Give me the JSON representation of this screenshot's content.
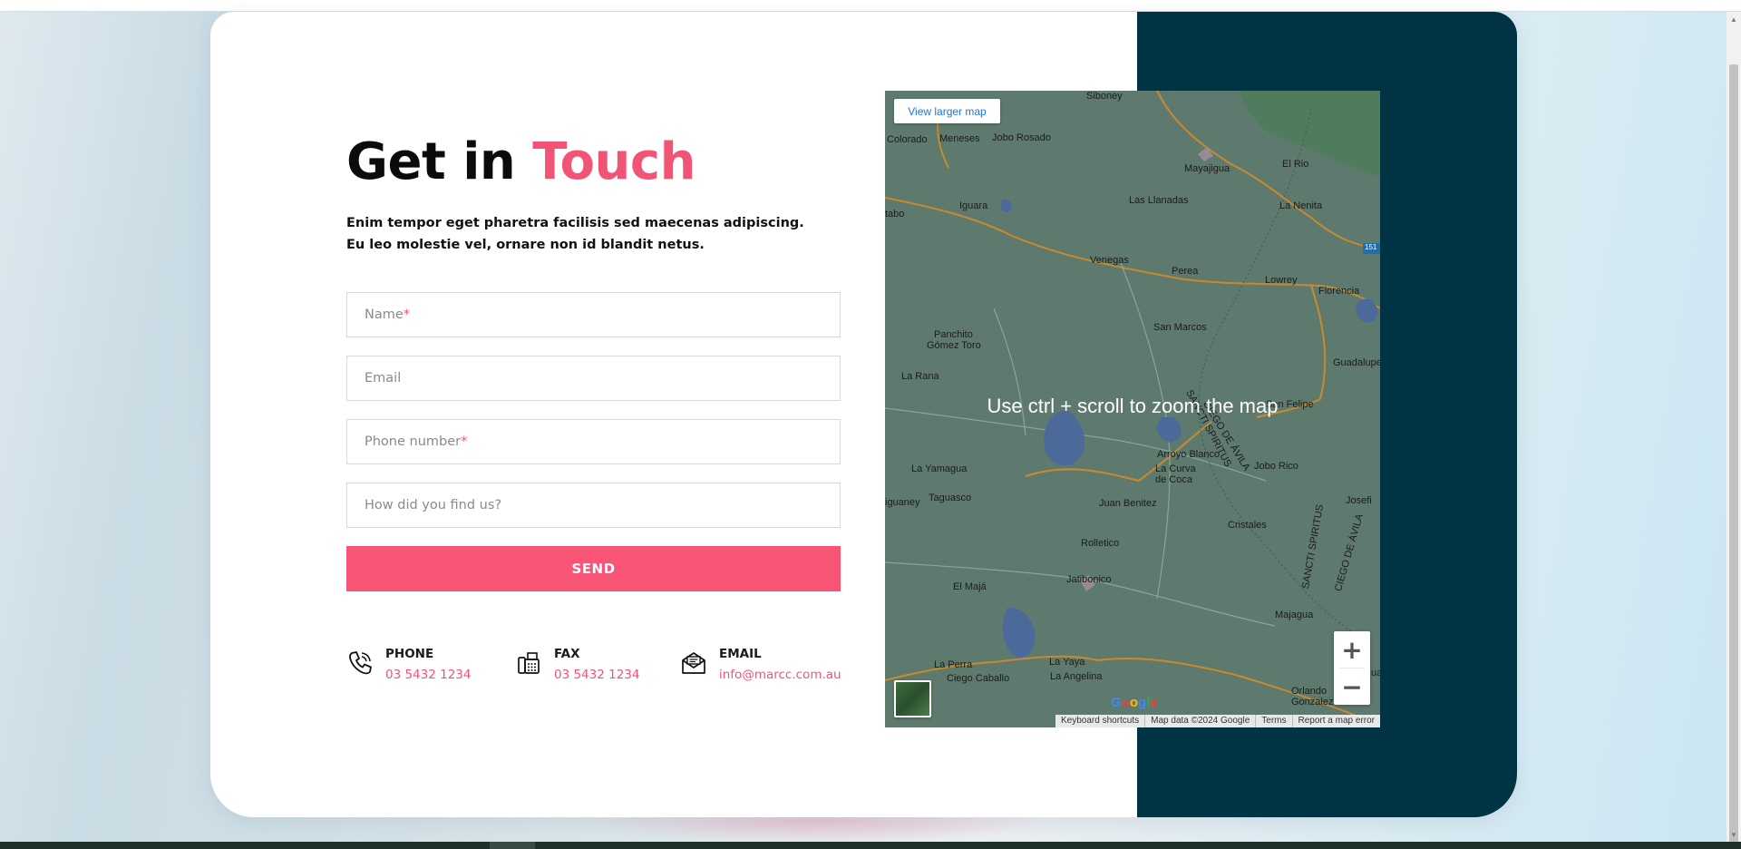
{
  "heading": {
    "prefix": "Get in",
    "accent": "Touch"
  },
  "intro": "Enim tempor eget pharetra facilisis sed maecenas adipiscing. Eu leo molestie vel, ornare non id blandit netus.",
  "form": {
    "name_placeholder": "Name",
    "email_placeholder": "Email",
    "phone_placeholder": "Phone number",
    "source_placeholder": "How did you find us?",
    "required_mark": "*",
    "send_label": "SEND"
  },
  "contacts": [
    {
      "label": "PHONE",
      "value": "03 5432 1234",
      "icon": "phone-icon"
    },
    {
      "label": "FAX",
      "value": "03 5432 1234",
      "icon": "fax-icon"
    },
    {
      "label": "EMAIL",
      "value": "info@marcc.com.au",
      "icon": "email-icon"
    }
  ],
  "map": {
    "larger_map_label": "View larger map",
    "zoom_hint": "Use ctrl + scroll to zoom the map",
    "zoom_in": "+",
    "zoom_out": "−",
    "logo": "Google",
    "attribution": [
      "Keyboard shortcuts",
      "Map data ©2024 Google",
      "Terms",
      "Report a map error"
    ],
    "road_badge": "151",
    "places": {
      "siboney": "Siboney",
      "colorado": "Colorado",
      "meneses": "Meneses",
      "jobo_rosado": "Jobo Rosado",
      "mayajigua": "Mayajigua",
      "el_rio": "El Rio",
      "las_llanadas": "Las Llanadas",
      "la_nenita": "La Nenita",
      "iguara": "Iguara",
      "tabo": "tabo",
      "venegas": "Venegas",
      "perea": "Perea",
      "lowrey": "Lowrey",
      "florencia": "Florencia",
      "panchito_1": "Panchito",
      "panchito_2": "Gómez Toro",
      "san_marcos": "San Marcos",
      "guadalupe": "Guadalupe",
      "la_rana": "La Rana",
      "ciego_avila_1": "CIEGO DE ÁVILA",
      "sancti_spiritus_1": "SANCTI SPIRITUS",
      "san_felipe": "San Felipe",
      "arroyo_blanco": "Arroyo Blanco",
      "la_curva_1": "La Curva",
      "la_curva_2": "de Coca",
      "la_yamagua": "La Yamagua",
      "jobo_rico": "Jobo Rico",
      "iguaney": "iguaney",
      "taguasco": "Taguasco",
      "juan_benitez": "Juan Benitez",
      "josefi": "Josefi",
      "cristales": "Cristales",
      "rolletico": "Rolletico",
      "el_maja": "El Majá",
      "jatibonico": "Jatibonico",
      "majagua": "Majagua",
      "sancti_spiritus_2": "SANCTI SPIRITUS",
      "ciego_avila_2": "CIEGO DE ÁVILA",
      "la_perra": "La Perra",
      "ciego_caballo": "Ciego Caballo",
      "la_yaya": "La Yaya",
      "la_angelina": "La Angelina",
      "orlando_1": "Orlando",
      "orlando_2": "Gonzalez",
      "ua": "ua"
    }
  }
}
